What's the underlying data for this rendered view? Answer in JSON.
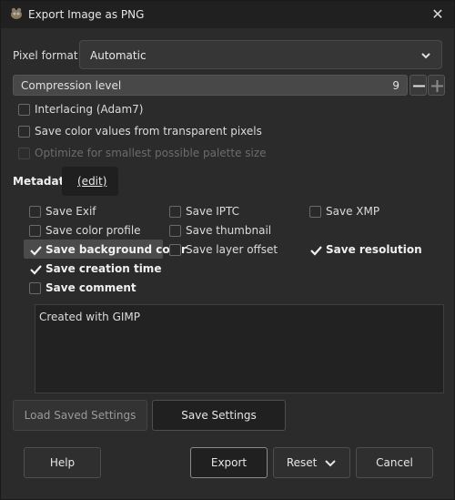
{
  "window": {
    "title": "Export Image as PNG"
  },
  "pixel_format": {
    "label": "Pixel format",
    "value": "Automatic"
  },
  "compression": {
    "label": "Compression level",
    "value": "9"
  },
  "options": {
    "interlacing": "Interlacing (Adam7)",
    "save_color_values": "Save color values from transparent pixels",
    "optimize_palette": "Optimize for smallest possible palette size"
  },
  "metadata": {
    "label": "Metadata",
    "edit_label": "(edit)",
    "save_exif": "Save Exif",
    "save_iptc": "Save IPTC",
    "save_xmp": "Save XMP",
    "save_color_profile": "Save color profile",
    "save_thumbnail": "Save thumbnail",
    "save_background_color": "Save background color",
    "save_layer_offset": "Save layer offset",
    "save_resolution": "Save resolution",
    "save_creation_time": "Save creation time",
    "save_comment": "Save comment",
    "comment_text": "Created with GIMP"
  },
  "buttons": {
    "load_saved_settings": "Load Saved Settings",
    "save_settings": "Save Settings",
    "help": "Help",
    "export": "Export",
    "reset": "Reset",
    "cancel": "Cancel"
  },
  "colors": {
    "background": "#2b2b2b",
    "titlebar": "#202020",
    "highlight": "#4b4b4b"
  }
}
